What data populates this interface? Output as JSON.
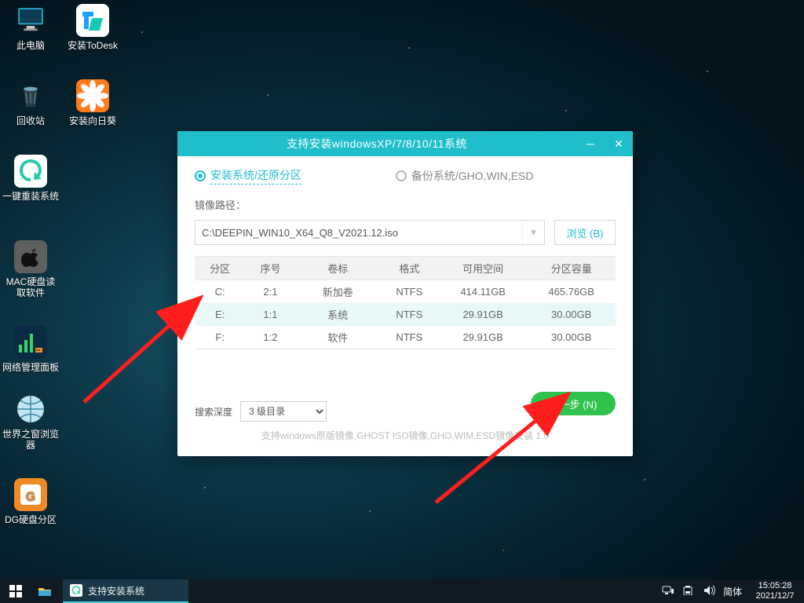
{
  "desktop": {
    "icons": [
      {
        "label": "此电脑"
      },
      {
        "label": "安装ToDesk"
      },
      {
        "label": "回收站"
      },
      {
        "label": "安装向日葵"
      },
      {
        "label": "一键重装系统"
      },
      {
        "label": "MAC硬盘读取软件"
      },
      {
        "label": "网络管理面板"
      },
      {
        "label": "世界之窗浏览器"
      },
      {
        "label": "DG硬盘分区"
      }
    ]
  },
  "installer": {
    "title": "支持安装windowsXP/7/8/10/11系统",
    "radio1": "安装系统/还原分区",
    "radio2": "备份系统/GHO,WIN,ESD",
    "imageLabel": "镜像路径：",
    "imagePath": "C:\\DEEPIN_WIN10_X64_Q8_V2021.12.iso",
    "browse": "浏览 (B)",
    "cols": {
      "c0": "分区",
      "c1": "序号",
      "c2": "卷标",
      "c3": "格式",
      "c4": "可用空间",
      "c5": "分区容量"
    },
    "rows": [
      {
        "drv": "C:",
        "idx": "2:1",
        "vol": "新加卷",
        "fmt": "NTFS",
        "free": "414.11GB",
        "cap": "465.76GB"
      },
      {
        "drv": "E:",
        "idx": "1:1",
        "vol": "系统",
        "fmt": "NTFS",
        "free": "29.91GB",
        "cap": "30.00GB"
      },
      {
        "drv": "F:",
        "idx": "1:2",
        "vol": "软件",
        "fmt": "NTFS",
        "free": "29.91GB",
        "cap": "30.00GB"
      }
    ],
    "depthLabel": "搜索深度",
    "depthValue": "3 级目录",
    "next": "下一步 (N)",
    "support": "支持windows原版镜像,GHOST ISO镜像,GHO,WIM,ESD镜像安装     1.0"
  },
  "taskbar": {
    "running": "支持安装系统",
    "ime": "简体",
    "time": "15:05:28",
    "date": "2021/12/7"
  }
}
